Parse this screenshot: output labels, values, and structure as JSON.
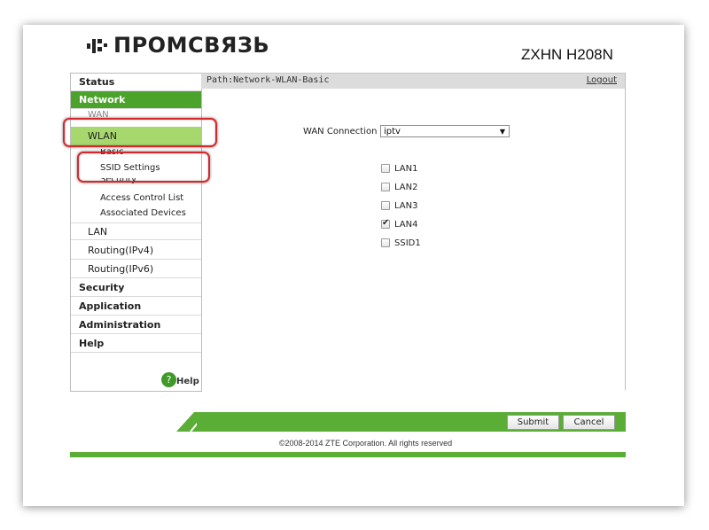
{
  "brand": {
    "logo_text": "ПРОМСВЯЗЬ",
    "model": "ZXHN H208N"
  },
  "sidebar": {
    "status": "Status",
    "network": "Network",
    "wan": "WAN",
    "wlan": "WLAN",
    "wlan_children": [
      "Basic",
      "SSID Settings",
      "Security",
      "Access Control List",
      "Associated Devices"
    ],
    "lan": "LAN",
    "routing_v4": "Routing(IPv4)",
    "routing_v6": "Routing(IPv6)",
    "security": "Security",
    "application": "Application",
    "administration": "Administration",
    "help": "Help",
    "help_icon_glyph": "?",
    "help_link": "Help"
  },
  "header": {
    "path": "Path:Network-WLAN-Basic",
    "logout": "Logout"
  },
  "form": {
    "wan_connection_label": "WAN Connection",
    "wan_connection_value": "iptv",
    "dropdown_arrow": "▼",
    "checkboxes": [
      {
        "label": "LAN1",
        "checked": false
      },
      {
        "label": "LAN2",
        "checked": false
      },
      {
        "label": "LAN3",
        "checked": false
      },
      {
        "label": "LAN4",
        "checked": true
      },
      {
        "label": "SSID1",
        "checked": false
      }
    ],
    "check_glyph": "✔"
  },
  "footer": {
    "submit": "Submit",
    "cancel": "Cancel",
    "copyright": "©2008-2014 ZTE Corporation. All rights reserved"
  },
  "colors": {
    "accent_green": "#4ca32c",
    "light_green": "#a7d86e",
    "highlight_red": "#d9262b"
  }
}
